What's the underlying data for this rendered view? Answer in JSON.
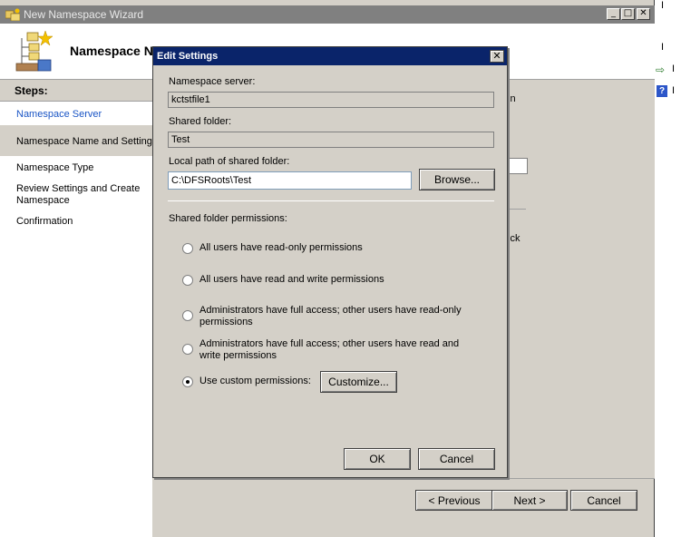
{
  "wizard": {
    "title": "New Namespace Wizard",
    "header_title": "Namespace N",
    "steps_heading": "Steps:",
    "steps": [
      "Namespace Server",
      "Namespace Name and Settings",
      "Namespace Type",
      "Review Settings and Create Namespace",
      "Confirmation"
    ],
    "fragments": {
      "in": "in",
      "ick": "ick"
    },
    "buttons": {
      "previous": "< Previous",
      "next": "Next >",
      "cancel": "Cancel"
    },
    "titlebar_glyphs": {
      "minimize": "_",
      "maximize": "□",
      "close": "✕"
    }
  },
  "dialog": {
    "title": "Edit Settings",
    "close_glyph": "✕",
    "server_label": "Namespace server:",
    "server_value": "kctstfile1",
    "shared_folder_label": "Shared folder:",
    "shared_folder_value": "Test",
    "local_path_label": "Local path of shared folder:",
    "local_path_value": "C:\\DFSRoots\\Test",
    "browse_label": "Browse...",
    "permissions_label": "Shared folder permissions:",
    "permission_options": [
      "All users have read-only permissions",
      "All users have read and write permissions",
      "Administrators have full access; other users have read-only permissions",
      "Administrators have full access; other users have read and write permissions",
      "Use custom permissions:"
    ],
    "selected_option": 4,
    "customize_label": "Customize...",
    "ok_label": "OK",
    "cancel_label": "Cancel"
  },
  "background": {
    "glyph_a": "I",
    "glyph_b": "I",
    "glyph_c": "I",
    "glyph_d": "I"
  },
  "colors": {
    "dialog_title_bg": "#0a246a",
    "inactive_title_bg": "#808080",
    "link": "#1a55c5",
    "face": "#d4d0c8"
  }
}
